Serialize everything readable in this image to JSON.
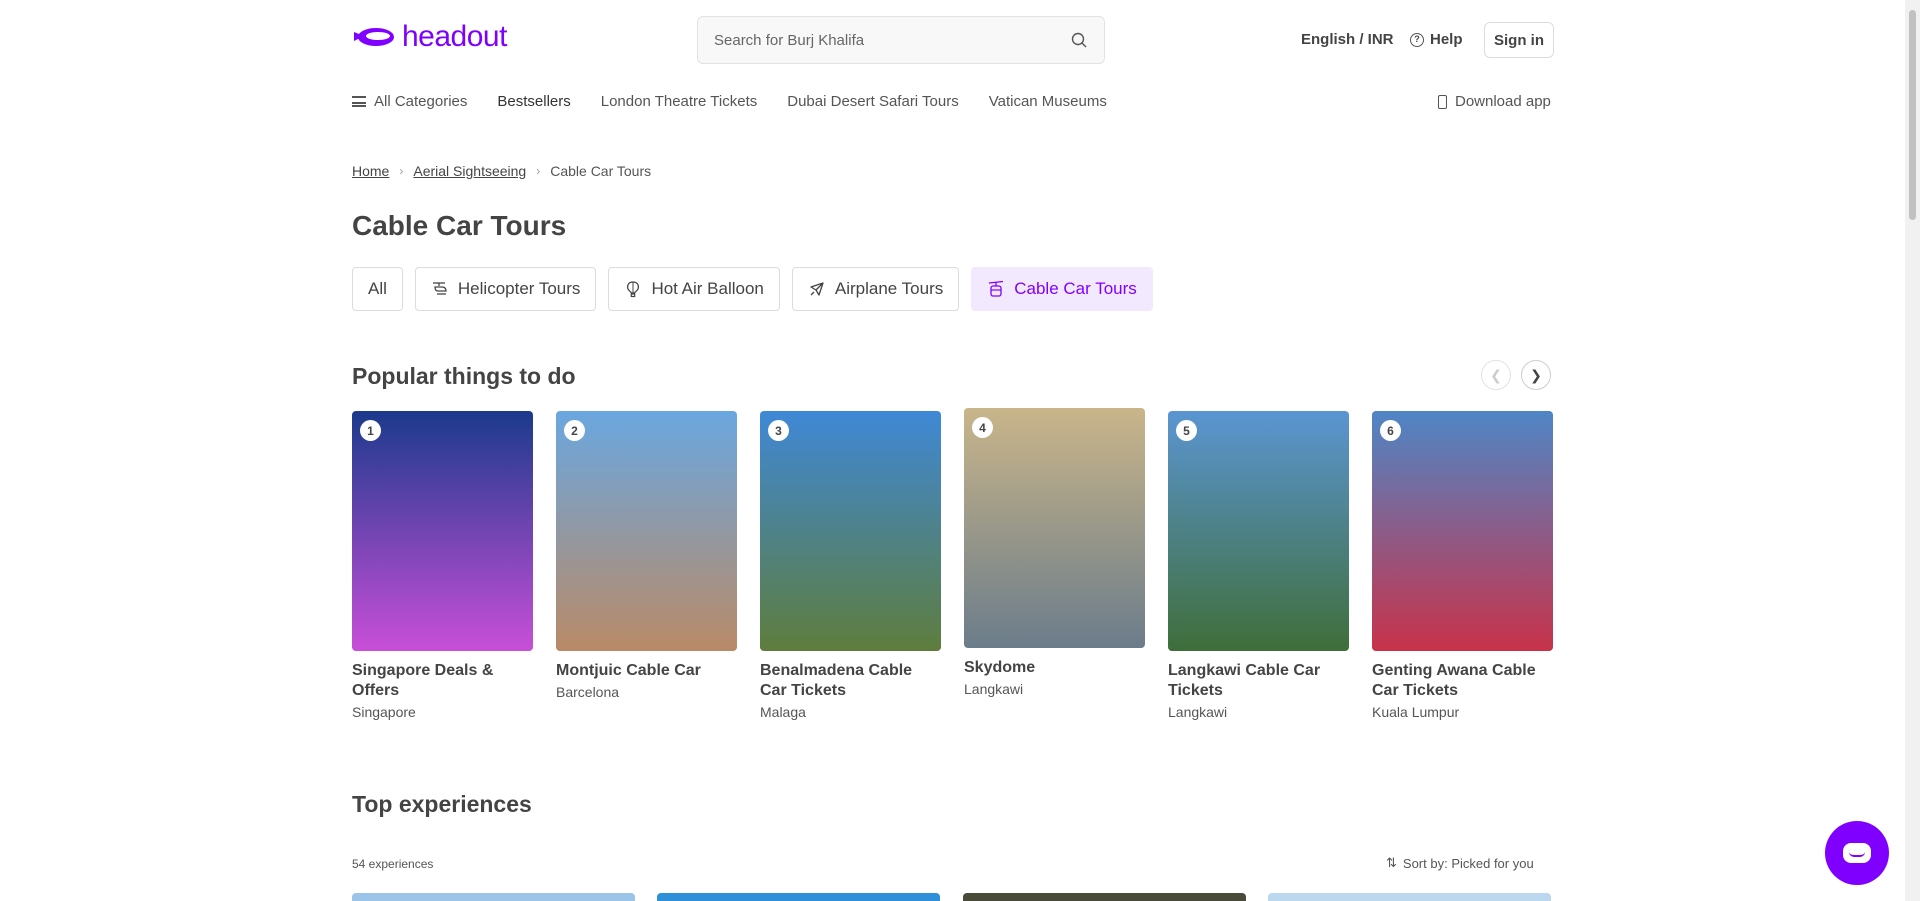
{
  "brand": {
    "name": "headout",
    "accent": "#8000ff"
  },
  "header": {
    "search_placeholder": "Search for Burj Khalifa",
    "lang_currency": "English / INR",
    "help": "Help",
    "sign_in": "Sign in"
  },
  "nav": {
    "items": [
      {
        "label": "All Categories",
        "icon": "menu-icon"
      },
      {
        "label": "Bestsellers"
      },
      {
        "label": "London Theatre Tickets"
      },
      {
        "label": "Dubai Desert Safari Tours"
      },
      {
        "label": "Vatican Museums"
      }
    ],
    "download_app": "Download app"
  },
  "breadcrumb": [
    "Home",
    "Aerial Sightseeing",
    "Cable Car Tours"
  ],
  "page_title": "Cable Car Tours",
  "chips": [
    {
      "label": "All",
      "icon": ""
    },
    {
      "label": "Helicopter Tours",
      "icon": "helicopter-icon"
    },
    {
      "label": "Hot Air Balloon",
      "icon": "balloon-icon"
    },
    {
      "label": "Airplane Tours",
      "icon": "airplane-icon"
    },
    {
      "label": "Cable Car Tours",
      "icon": "cable-car-icon",
      "active": true
    }
  ],
  "popular": {
    "title": "Popular things to do",
    "cards": [
      {
        "rank": "1",
        "title": "Singapore Deals & Offers",
        "location": "Singapore",
        "image": "supertree-grove-photo",
        "colors": [
          "#1b3a8c",
          "#c84fd8"
        ]
      },
      {
        "rank": "2",
        "title": "Montjuic Cable Car",
        "location": "Barcelona",
        "image": "barcelona-cable-car-photo",
        "colors": [
          "#6aa7e0",
          "#b98a67"
        ]
      },
      {
        "rank": "3",
        "title": "Benalmadena Cable Car Tickets",
        "location": "Malaga",
        "image": "benalmadena-cable-car-photo",
        "colors": [
          "#3f88d6",
          "#5e7d3d"
        ]
      },
      {
        "rank": "4",
        "title": "Skydome",
        "location": "Langkawi",
        "image": "tourists-photo",
        "colors": [
          "#c9b58a",
          "#6b7c8a"
        ]
      },
      {
        "rank": "5",
        "title": "Langkawi Cable Car Tickets",
        "location": "Langkawi",
        "image": "langkawi-cable-car-photo",
        "colors": [
          "#5b95d2",
          "#3f6e3a"
        ]
      },
      {
        "rank": "6",
        "title": "Genting Awana Cable Car Tickets",
        "location": "Kuala Lumpur",
        "image": "genting-cable-car-photo",
        "colors": [
          "#4f86c6",
          "#c8324a"
        ]
      }
    ]
  },
  "top_experiences": {
    "title": "Top experiences",
    "count": "54 experiences",
    "sort": "Sort by: Picked for you"
  }
}
